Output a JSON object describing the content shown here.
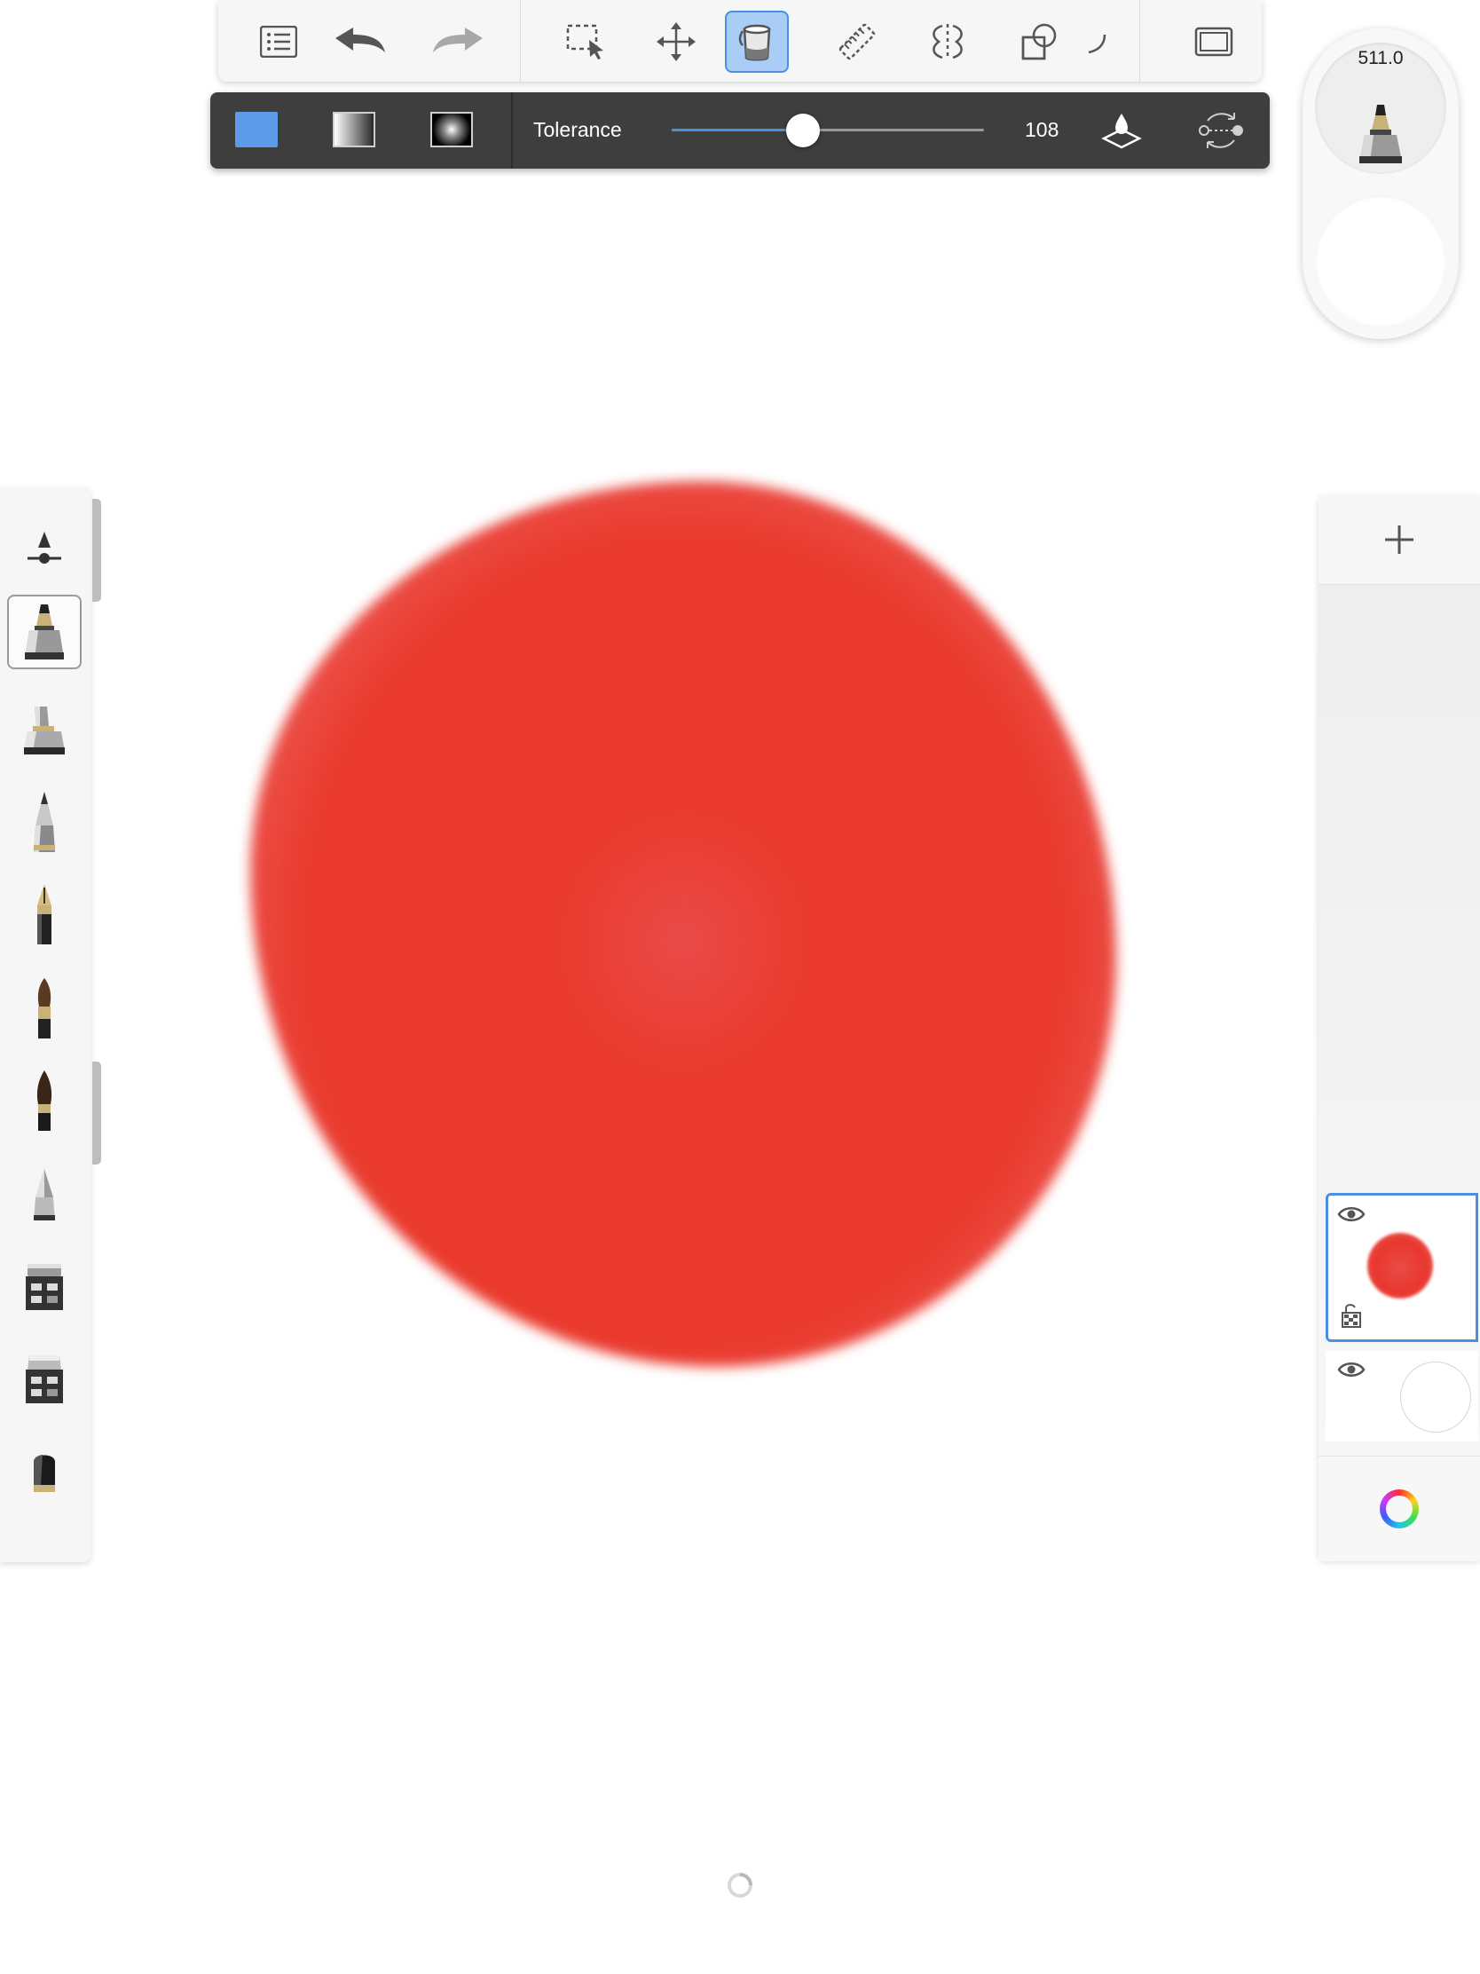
{
  "toolbar": {
    "buttons": [
      "list-icon",
      "undo-icon",
      "redo-icon",
      "selection-icon",
      "transform-icon",
      "fill-icon",
      "ruler-icon",
      "symmetry-icon",
      "shapes-icon",
      "curve-icon",
      "fullscreen-icon"
    ],
    "active": "fill-icon"
  },
  "fill_options": {
    "modes": [
      "solid-fill",
      "linear-gradient-fill",
      "radial-gradient-fill"
    ],
    "selected_mode": "solid-fill",
    "solid_color": "#5b9be8",
    "tolerance_label": "Tolerance",
    "tolerance_value": "108",
    "tolerance_fraction": 0.42
  },
  "brush_puck": {
    "size": "511.0",
    "opacity_color": "#ffffff"
  },
  "brush_palette": {
    "brushes": [
      "brush-properties",
      "marker",
      "inking-marker",
      "pencil",
      "ballpoint-pen",
      "paintbrush",
      "ink-brush",
      "airbrush",
      "blender",
      "eraser",
      "smudge"
    ],
    "selected": "marker"
  },
  "canvas": {
    "shape_color": "#ea3a2d"
  },
  "layers": {
    "items": [
      {
        "name": "layer-1",
        "selected": true,
        "visible": true
      },
      {
        "name": "background-layer",
        "selected": false,
        "visible": true
      }
    ],
    "accent": "#4a90e2"
  }
}
